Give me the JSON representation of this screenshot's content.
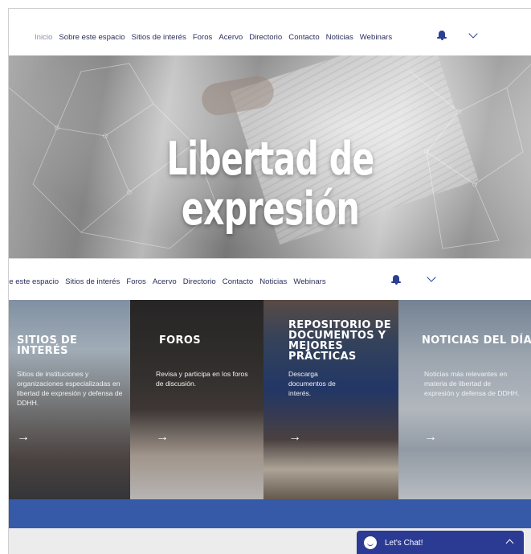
{
  "nav_top": {
    "items": [
      "Inicio",
      "Sobre este espacio",
      "Sitios de interés",
      "Foros",
      "Acervo",
      "Directorio",
      "Contacto",
      "Noticias",
      "Webinars"
    ]
  },
  "hero": {
    "title_line1": "Libertad de",
    "title_line2": "expresión"
  },
  "nav_second": {
    "items": [
      "re este espacio",
      "Sitios de interés",
      "Foros",
      "Acervo",
      "Directorio",
      "Contacto",
      "Noticias",
      "Webinars"
    ]
  },
  "cards": [
    {
      "title": "SITIOS DE INTERÉS",
      "text": "Sitios de instituciones y organizaciones especializadas en libertad de expresión y defensa de DDHH.",
      "arrow": "→"
    },
    {
      "title": "FOROS",
      "text": "Revisa y participa en los foros de discusión.",
      "arrow": "→"
    },
    {
      "title_lines": [
        "REPOSITORIO DE",
        "DOCUMENTOS Y",
        "MEJORES PRÁCTICAS"
      ],
      "text": "Descarga documentos de interés.",
      "arrow": "→"
    },
    {
      "title": "NOTICIAS DEL DÍA",
      "text": "Noticias más relevantes en materia de libertad de expresión y defensa de DDHH.",
      "arrow": "→"
    }
  ],
  "chat": {
    "label": "Let's Chat!"
  },
  "colors": {
    "nav_text": "#2a2f5c",
    "accent": "#2c3f91",
    "band": "#3659a8",
    "chat_bg": "#2b3a93"
  }
}
